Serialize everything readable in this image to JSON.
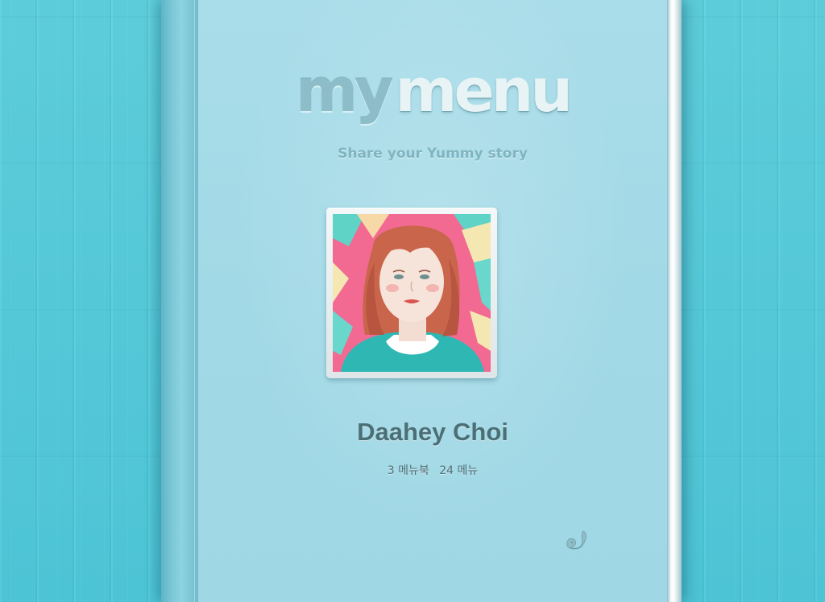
{
  "colors": {
    "background": "#55cbdb",
    "cover": "#a6dae7",
    "spine": "#7cc8d8",
    "name_text": "#4b6f76"
  },
  "logo": {
    "part1": "my",
    "part2": "menu"
  },
  "tagline": "Share your Yummy story",
  "profile": {
    "name": "Daahey Choi",
    "menubooks": "3 메뉴북",
    "menus": "24 메뉴",
    "avatar_icon": "user-portrait"
  },
  "brand_icon": "squirrel-icon"
}
